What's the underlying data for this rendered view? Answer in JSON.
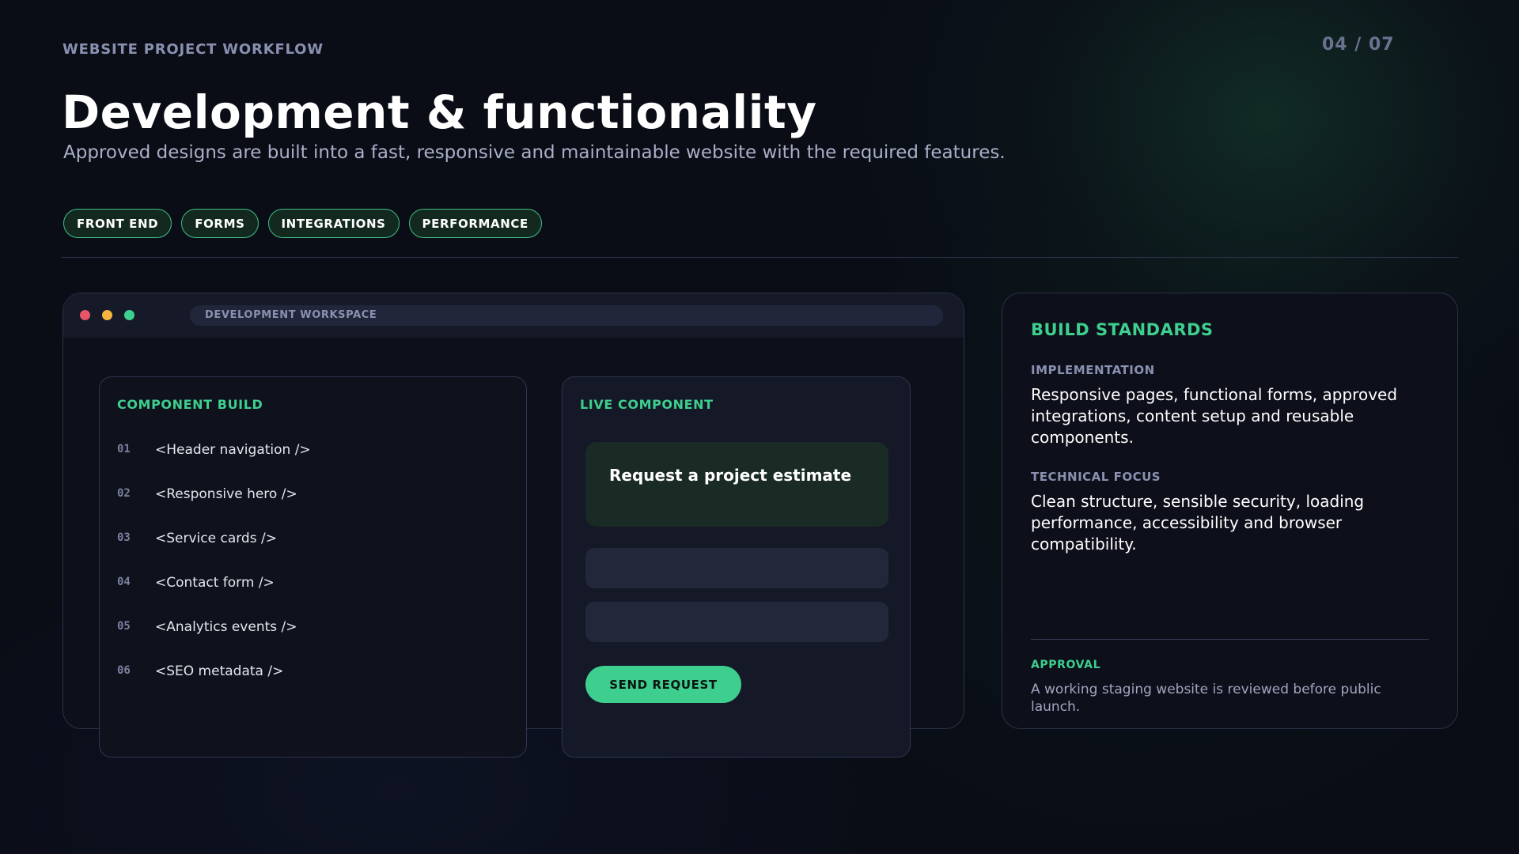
{
  "header": {
    "eyebrow": "WEBSITE PROJECT WORKFLOW",
    "page_indicator": "04 / 07",
    "title": "Development & functionality",
    "subtitle": "Approved designs are built into a fast, responsive and maintainable website with the required features."
  },
  "tags": [
    "FRONT END",
    "FORMS",
    "INTEGRATIONS",
    "PERFORMANCE"
  ],
  "workspace": {
    "address_bar": "DEVELOPMENT WORKSPACE",
    "component_build": {
      "label": "COMPONENT BUILD",
      "items": [
        {
          "num": "01",
          "tag": "<Header navigation />"
        },
        {
          "num": "02",
          "tag": "<Responsive hero />"
        },
        {
          "num": "03",
          "tag": "<Service cards />"
        },
        {
          "num": "04",
          "tag": "<Contact form />"
        },
        {
          "num": "05",
          "tag": "<Analytics events />"
        },
        {
          "num": "06",
          "tag": "<SEO metadata />"
        }
      ]
    },
    "live_component": {
      "label": "LIVE COMPONENT",
      "card_title": "Request a project estimate",
      "button_label": "SEND REQUEST"
    }
  },
  "standards": {
    "title": "BUILD STANDARDS",
    "implementation_label": "IMPLEMENTATION",
    "implementation_text": "Responsive pages, functional forms, approved integrations, content setup and reusable components.",
    "technical_label": "TECHNICAL FOCUS",
    "technical_text": "Clean structure, sensible security, loading performance, accessibility and browser compatibility.",
    "approval_label": "APPROVAL",
    "approval_text": "A working staging website is reviewed before public launch."
  },
  "colors": {
    "accent": "#3ecf8e",
    "background": "#0a0d16",
    "window_dot_red": "#e85468",
    "window_dot_yellow": "#f3b540",
    "window_dot_green": "#3ecf8e"
  }
}
